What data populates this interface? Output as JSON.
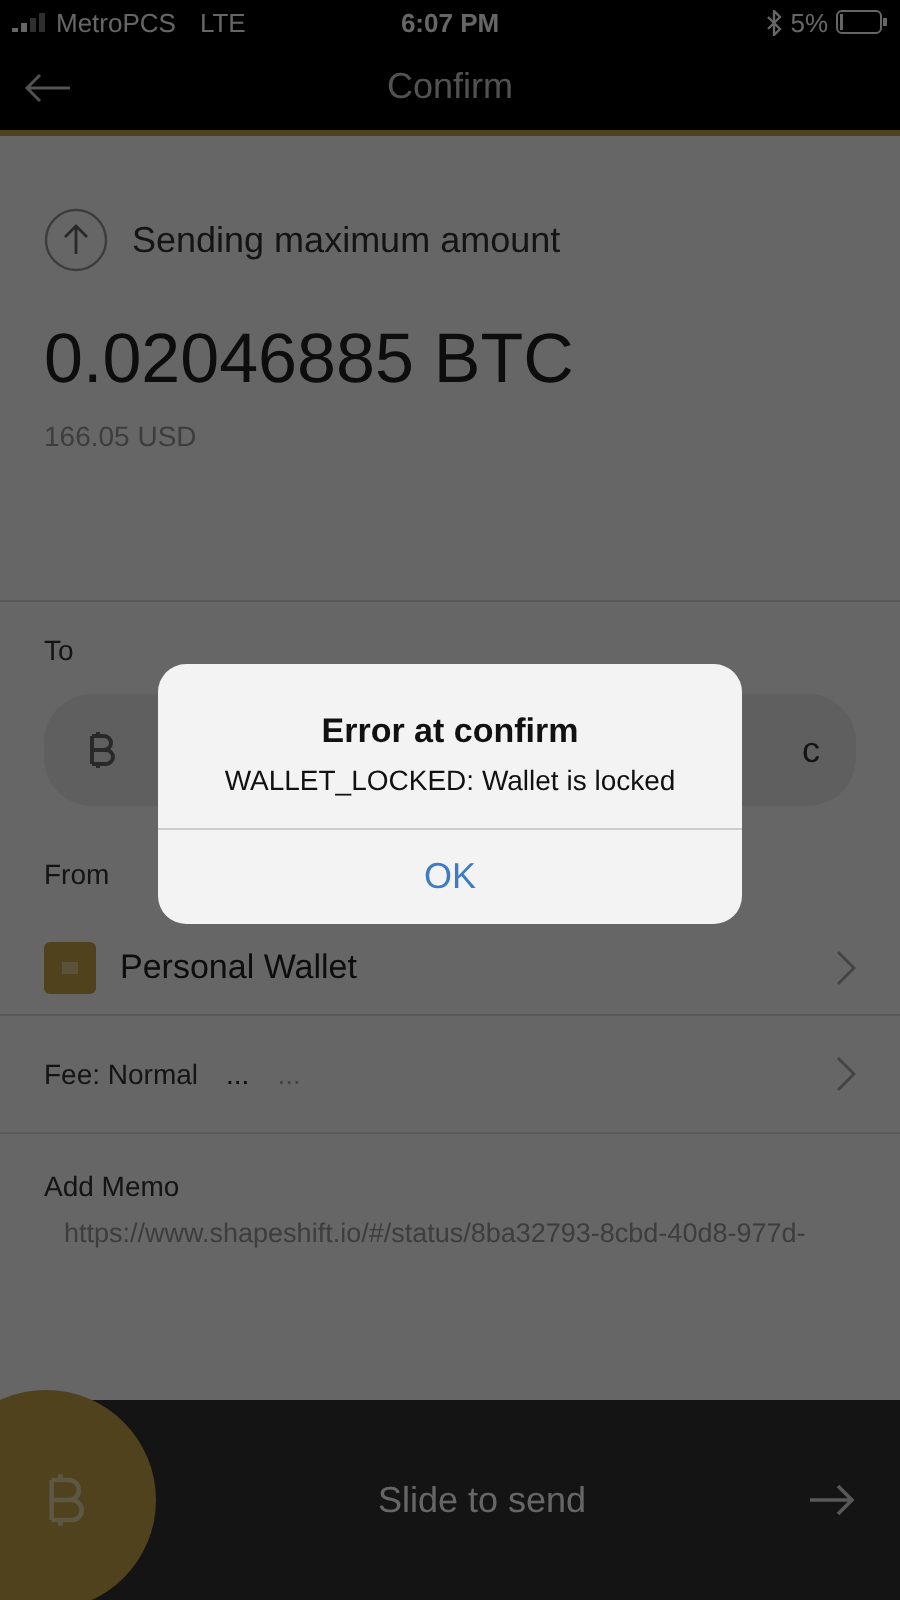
{
  "status_bar": {
    "carrier": "MetroPCS",
    "network": "LTE",
    "time": "6:07 PM",
    "battery": "5%"
  },
  "header": {
    "title": "Confirm"
  },
  "summary": {
    "label": "Sending maximum amount",
    "amount": "0.02046885",
    "unit": "BTC",
    "fiat": "166.05 USD"
  },
  "to": {
    "label": "To",
    "value": "c"
  },
  "from": {
    "label": "From",
    "wallet": "Personal Wallet"
  },
  "fee": {
    "label": "Fee: Normal",
    "value": "...",
    "secondary": "..."
  },
  "memo": {
    "label": "Add Memo",
    "value": "https://www.shapeshift.io/#/status/8ba32793-8cbd-40d8-977d-"
  },
  "slider": {
    "label": "Slide to send"
  },
  "alert": {
    "title": "Error at confirm",
    "message": "WALLET_LOCKED: Wallet is locked",
    "button": "OK"
  }
}
